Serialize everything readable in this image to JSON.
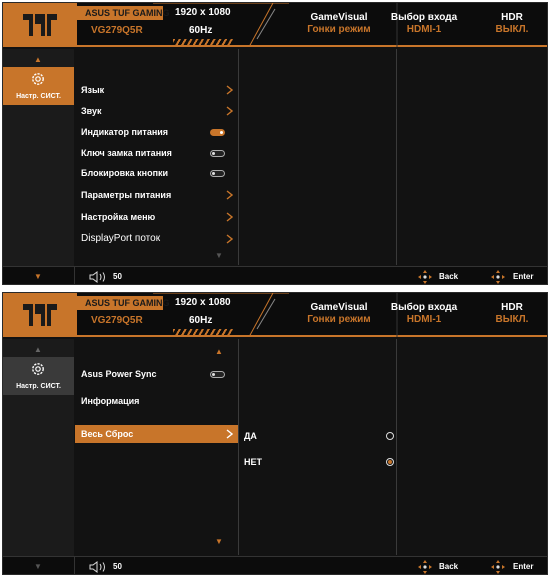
{
  "screens": [
    {
      "header": {
        "model_tag": "ASUS TUF GAMING",
        "model": "VG279Q5R",
        "resolution": "1920 x 1080",
        "refresh": "60Hz",
        "gamevisual_label": "GameVisual",
        "gamevisual_value": "Гонки режим",
        "input_label": "Выбор входа",
        "input_value": "HDMI-1",
        "hdr_label": "HDR",
        "hdr_value": "ВЫКЛ."
      },
      "sidebar": {
        "label": "Настр. СИСТ.",
        "icon": "gear-icon"
      },
      "menu": [
        {
          "label": "Язык",
          "control": "chevron"
        },
        {
          "label": "Звук",
          "control": "chevron"
        },
        {
          "label": "Индикатор питания",
          "control": "toggle-on"
        },
        {
          "label": "Ключ замка питания",
          "control": "toggle-off"
        },
        {
          "label": "Блокировка кнопки",
          "control": "toggle-off"
        },
        {
          "label": "Параметры питания",
          "control": "chevron"
        },
        {
          "label": "Настройка меню",
          "control": "chevron"
        },
        {
          "label": "DisplayPort поток",
          "control": "chevron"
        }
      ],
      "footer": {
        "volume": "50",
        "back": "Back",
        "enter": "Enter"
      }
    },
    {
      "header": {
        "model_tag": "ASUS TUF GAMING",
        "model": "VG279Q5R",
        "resolution": "1920 x 1080",
        "refresh": "60Hz",
        "gamevisual_label": "GameVisual",
        "gamevisual_value": "Гонки режим",
        "input_label": "Выбор входа",
        "input_value": "HDMI-1",
        "hdr_label": "HDR",
        "hdr_value": "ВЫКЛ."
      },
      "sidebar": {
        "label": "Настр. СИСТ.",
        "icon": "gear-icon"
      },
      "menu": [
        {
          "label": "Asus Power Sync",
          "control": "toggle-off"
        },
        {
          "label": "Информация",
          "control": "none"
        },
        {
          "label": "Весь Сброс",
          "control": "chevron",
          "selected": true
        }
      ],
      "submenu": [
        {
          "label": "ДА",
          "selected": false
        },
        {
          "label": "НЕТ",
          "selected": true
        }
      ],
      "footer": {
        "volume": "50",
        "back": "Back",
        "enter": "Enter"
      }
    }
  ],
  "colors": {
    "accent": "#c8752a",
    "background": "#121212",
    "sidebar": "#1b1b1b"
  }
}
